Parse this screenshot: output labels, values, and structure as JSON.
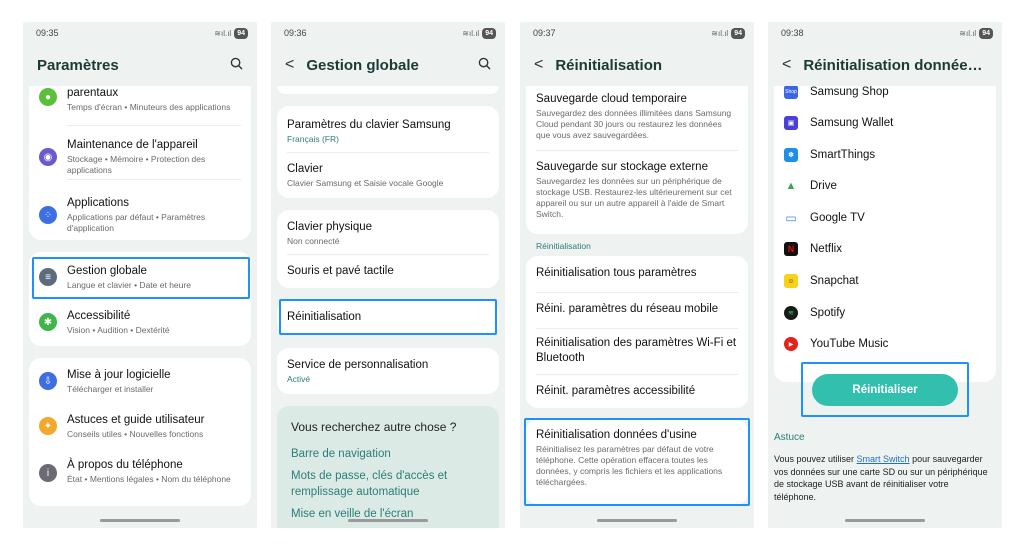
{
  "battery": "94",
  "colors": {
    "highlight": "#1e90ff",
    "accent": "#2c7d78",
    "button": "#33bfae"
  },
  "screen1": {
    "time": "09:35",
    "title": "Paramètres",
    "items": [
      {
        "title": "parentaux",
        "subtitle": "Temps d'écran • Minuteurs des applications",
        "icon": "parental-controls-icon"
      },
      {
        "title": "Maintenance de l'appareil",
        "subtitle": "Stockage • Mémoire • Protection des applications",
        "icon": "device-care-icon"
      },
      {
        "title": "Applications",
        "subtitle": "Applications par défaut • Paramètres d'application",
        "icon": "apps-icon"
      },
      {
        "title": "Gestion globale",
        "subtitle": "Langue et clavier • Date et heure",
        "icon": "general-management-icon"
      },
      {
        "title": "Accessibilité",
        "subtitle": "Vision • Audition • Dextérité",
        "icon": "accessibility-icon"
      },
      {
        "title": "Mise à jour logicielle",
        "subtitle": "Télécharger et installer",
        "icon": "software-update-icon"
      },
      {
        "title": "Astuces et guide utilisateur",
        "subtitle": "Conseils utiles • Nouvelles fonctions",
        "icon": "tips-icon"
      },
      {
        "title": "À propos du téléphone",
        "subtitle": "État • Mentions légales • Nom du téléphone",
        "icon": "info-icon"
      }
    ]
  },
  "screen2": {
    "time": "09:36",
    "title": "Gestion globale",
    "items": [
      {
        "title": "Paramètres du clavier Samsung",
        "subtitle": "Français (FR)"
      },
      {
        "title": "Clavier",
        "subtitle": "Clavier Samsung et Saisie vocale Google"
      },
      {
        "title": "Clavier physique",
        "subtitle": "Non connecté"
      },
      {
        "title": "Souris et pavé tactile",
        "subtitle": ""
      },
      {
        "title": "Réinitialisation",
        "subtitle": ""
      },
      {
        "title": "Service de personnalisation",
        "subtitle": "Activé"
      }
    ],
    "suggest_title": "Vous recherchez autre chose ?",
    "suggest_links": [
      "Barre de navigation",
      "Mots de passe, clés d'accès et remplissage automatique",
      "Mise en veille de l'écran"
    ]
  },
  "screen3": {
    "time": "09:37",
    "title": "Réinitialisation",
    "backup": [
      {
        "title": "Sauvegarde cloud temporaire",
        "subtitle": "Sauvegardez des données illimitées dans Samsung Cloud pendant 30 jours ou restaurez les données que vous avez sauvegardées."
      },
      {
        "title": "Sauvegarde sur stockage externe",
        "subtitle": "Sauvegardez les données sur un périphérique de stockage USB. Restaurez-les ultérieurement sur cet appareil ou sur un autre appareil à l'aide de Smart Switch."
      }
    ],
    "section_label": "Réinitialisation",
    "reset": [
      "Réinitialisation tous paramètres",
      "Réini. paramètres du réseau mobile",
      "Réinitialisation des paramètres Wi-Fi et Bluetooth",
      "Réinit. paramètres accessibilité"
    ],
    "factory": {
      "title": "Réinitialisation données d'usine",
      "subtitle": "Réinitialisez les paramètres par défaut de votre téléphone. Cette opération effacera toutes les données, y compris les fichiers et les applications téléchargées."
    }
  },
  "screen4": {
    "time": "09:38",
    "title": "Réinitialisation données...",
    "apps": [
      {
        "name": "Samsung Shop",
        "icon_text": "Shop",
        "color": "#3b64e6"
      },
      {
        "name": "Samsung Wallet",
        "icon_text": "",
        "color": "#4a3fd6"
      },
      {
        "name": "SmartThings",
        "icon_text": "✽",
        "color": "#1d8fe8"
      },
      {
        "name": "Drive",
        "icon_text": "▲",
        "color": "#34a853"
      },
      {
        "name": "Google TV",
        "icon_text": "▭",
        "color": "#4285f4"
      },
      {
        "name": "Netflix",
        "icon_text": "N",
        "color": "#111111"
      },
      {
        "name": "Snapchat",
        "icon_text": "☺",
        "color": "#f7d21b"
      },
      {
        "name": "Spotify",
        "icon_text": "≋",
        "color": "#1a1a1a"
      },
      {
        "name": "YouTube Music",
        "icon_text": "▶",
        "color": "#e62117"
      }
    ],
    "button": "Réinitialiser",
    "tip_title": "Astuce",
    "tip_before": "Vous pouvez utiliser ",
    "tip_link": "Smart Switch",
    "tip_after": " pour sauvegarder vos données sur une carte SD ou sur un périphérique de stockage USB avant de réinitialiser votre téléphone."
  }
}
